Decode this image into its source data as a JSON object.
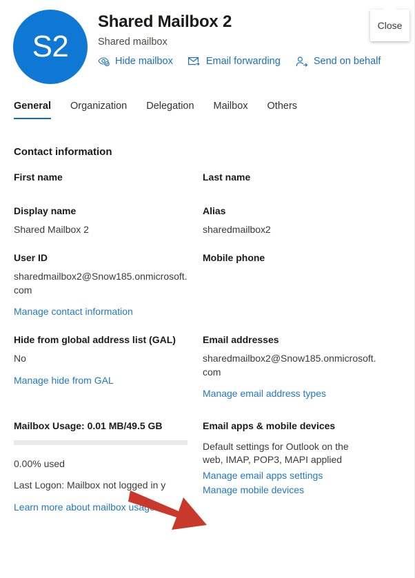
{
  "header": {
    "avatar_initials": "S2",
    "title": "Shared Mailbox 2",
    "subtitle": "Shared mailbox",
    "close_label": "Close",
    "accent_color": "#0f78d4",
    "link_color": "#2278c6",
    "actions": [
      {
        "label": "Hide mailbox",
        "icon": "hide-mailbox-eye-icon"
      },
      {
        "label": "Email forwarding",
        "icon": "envelope-forward-icon"
      },
      {
        "label": "Send on behalf",
        "icon": "person-arrow-icon"
      }
    ]
  },
  "tabs": [
    {
      "label": "General",
      "active": true
    },
    {
      "label": "Organization",
      "active": false
    },
    {
      "label": "Delegation",
      "active": false
    },
    {
      "label": "Mailbox",
      "active": false
    },
    {
      "label": "Others",
      "active": false
    }
  ],
  "main": {
    "section_title": "Contact information",
    "fields": {
      "first_name_label": "First name",
      "first_name_value": "",
      "last_name_label": "Last name",
      "last_name_value": "",
      "display_name_label": "Display name",
      "display_name_value": "Shared Mailbox 2",
      "alias_label": "Alias",
      "alias_value": "sharedmailbox2",
      "user_id_label": "User ID",
      "user_id_value": "sharedmailbox2@Snow185.onmicrosoft.com",
      "mobile_phone_label": "Mobile phone",
      "mobile_phone_value": "",
      "manage_contact_link": "Manage contact information",
      "hide_gal_label": "Hide from global address list (GAL)",
      "hide_gal_value": "No",
      "hide_gal_link": "Manage hide from GAL",
      "email_addresses_label": "Email addresses",
      "email_addresses_value": "sharedmailbox2@Snow185.onmicrosoft.com",
      "email_addresses_link": "Manage email address types"
    },
    "usage": {
      "title": "Mailbox Usage: 0.01 MB/49.5 GB",
      "percent_used_text": "0.00% used",
      "percent_used_value": 0,
      "last_logon_text": "Last Logon: Mailbox not logged in y",
      "learn_more_link": "Learn more about mailbox usage"
    },
    "apps": {
      "title": "Email apps & mobile devices",
      "description": "Default settings for Outlook on the web, IMAP, POP3, MAPI applied",
      "manage_apps_link": "Manage email apps settings",
      "manage_devices_link": "Manage mobile devices"
    }
  },
  "annotation": {
    "arrow_color": "#c8392b",
    "arrow_name": "red-pointer-arrow"
  }
}
